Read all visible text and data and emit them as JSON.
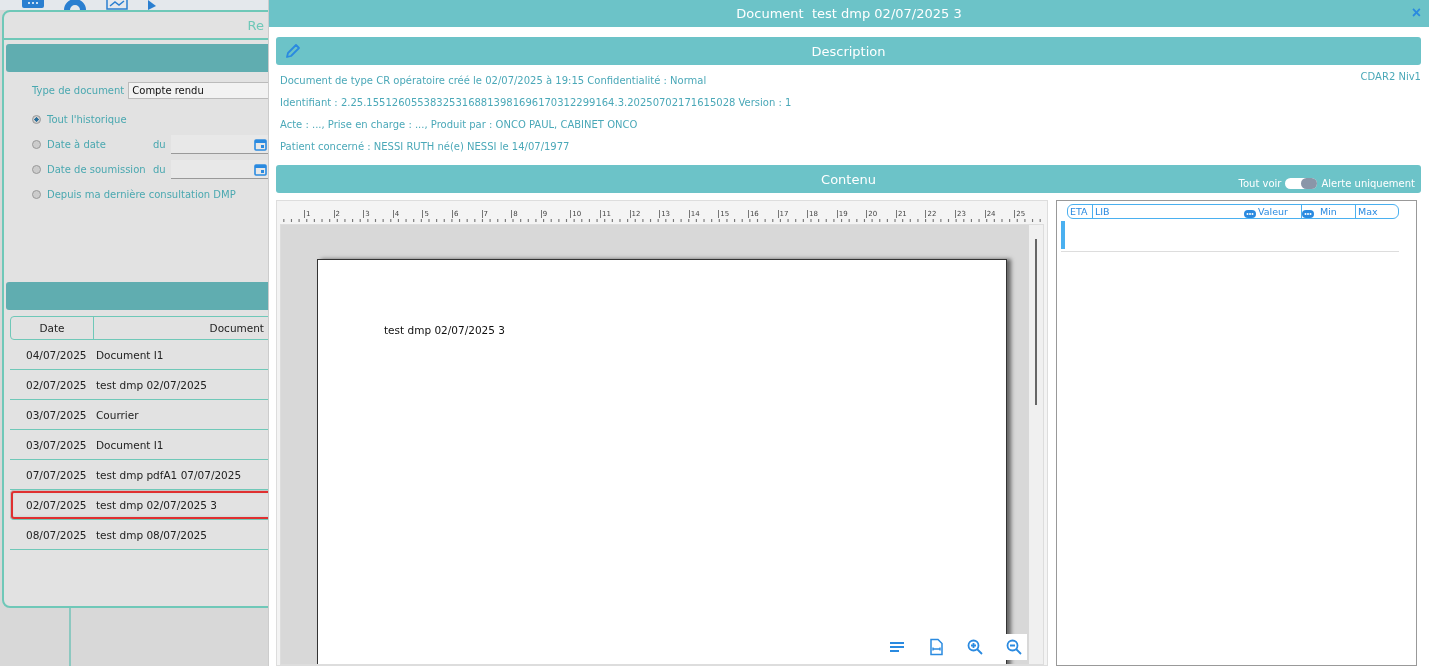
{
  "background_window": {
    "title": "Re",
    "form": {
      "document_type_label": "Type de document",
      "document_type_value": "Compte rendu",
      "options": [
        {
          "kind": "plain",
          "label": "Tout l'historique",
          "selected": true
        },
        {
          "kind": "date",
          "label": "Date à date",
          "from_label": "du",
          "selected": false
        },
        {
          "kind": "date",
          "label": "Date de soumission",
          "from_label": "du",
          "selected": false
        },
        {
          "kind": "plain",
          "label": "Depuis ma dernière consultation DMP",
          "selected": false
        }
      ]
    },
    "table": {
      "columns": [
        "Date",
        "Document"
      ],
      "rows": [
        {
          "date": "04/07/2025",
          "document": "Document I1",
          "selected": false
        },
        {
          "date": "02/07/2025",
          "document": "test dmp 02/07/2025",
          "selected": false
        },
        {
          "date": "03/07/2025",
          "document": "Courrier",
          "selected": false
        },
        {
          "date": "03/07/2025",
          "document": "Document I1",
          "selected": false
        },
        {
          "date": "07/07/2025",
          "document": "test dmp pdfA1 07/07/2025",
          "selected": false
        },
        {
          "date": "02/07/2025",
          "document": "test dmp 02/07/2025 3",
          "selected": true
        },
        {
          "date": "08/07/2025",
          "document": "test dmp 08/07/2025",
          "selected": false
        }
      ]
    }
  },
  "dialog": {
    "title": "Document  test dmp 02/07/2025 3",
    "close": "×",
    "description": {
      "title": "Description",
      "level_tag": "CDAR2 Niv1",
      "lines": [
        "Document de type CR opératoire créé le 02/07/2025 à 19:15 Confidentialité : Normal",
        "Identifiant : 2.25.155126055383253168813981696170312299164.3.20250702171615028 Version : 1",
        "Acte : ..., Prise en charge : ..., Produit par :  ONCO PAUL, CABINET ONCO",
        "Patient concerné : NESSI RUTH né(e) NESSI le 14/07/1977"
      ]
    },
    "content": {
      "title": "Contenu",
      "toggle": {
        "left_label": "Tout voir",
        "right_label": "Alerte uniquement",
        "on": true
      },
      "ruler": [
        "1",
        "2",
        "3",
        "4",
        "5",
        "6",
        "7",
        "8",
        "9",
        "10",
        "11",
        "12",
        "13",
        "14",
        "15",
        "16",
        "17",
        "18",
        "19",
        "20",
        "21",
        "22",
        "23",
        "24",
        "25"
      ],
      "page_text": "test dmp 02/07/2025 3",
      "results_columns": [
        "ETA",
        "LIB",
        "Valeur",
        "Min",
        "Max"
      ]
    }
  }
}
